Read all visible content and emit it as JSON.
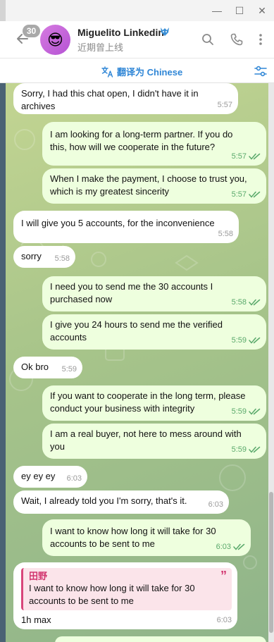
{
  "window": {
    "minimize_glyph": "—",
    "maximize_glyph": "☐",
    "close_glyph": "✕"
  },
  "header": {
    "unread_count": "30",
    "name": "Miguelito Linkedin",
    "status": "近期曾上线",
    "avatar_emoji": "😎",
    "icons": [
      "arrow-left-icon",
      "verified-wolf-icon",
      "search-icon",
      "phone-icon",
      "more-vertical-icon"
    ]
  },
  "translate_bar": {
    "label": "翻译为 Chinese",
    "icons": [
      "translate-icon",
      "settings-sliders-icon"
    ]
  },
  "messages": [
    {
      "dir": "in",
      "lines": [
        "Sorry, I had this chat open, I didn't have it in",
        "archives"
      ],
      "time": "5:57"
    },
    {
      "dir": "out",
      "lines": [
        "I am looking for a long-term partner. If you do",
        "this, how will we cooperate in the future?"
      ],
      "time": "5:57",
      "read": true
    },
    {
      "dir": "out",
      "lines": [
        "When I make the payment, I choose to trust you,",
        "which is my greatest sincerity"
      ],
      "time": "5:57",
      "read": true
    },
    {
      "dir": "in",
      "lines": [
        "I will give you 5 accounts, for the inconvenience"
      ],
      "time": "5:58"
    },
    {
      "dir": "in",
      "lines": [
        "sorry"
      ],
      "time": "5:58"
    },
    {
      "dir": "out",
      "lines": [
        "I need you to send me the 30 accounts I",
        "purchased now"
      ],
      "time": "5:58",
      "read": true
    },
    {
      "dir": "out",
      "lines": [
        "I give you 24 hours to send me the verified",
        "accounts"
      ],
      "time": "5:59",
      "read": true
    },
    {
      "dir": "in",
      "lines": [
        "Ok bro"
      ],
      "time": "5:59"
    },
    {
      "dir": "out",
      "lines": [
        "If you want to cooperate in the long term, please",
        "conduct your business with integrity"
      ],
      "time": "5:59",
      "read": true
    },
    {
      "dir": "out",
      "lines": [
        "I am a real buyer, not here to mess around with",
        "you"
      ],
      "time": "5:59",
      "read": true
    },
    {
      "dir": "in",
      "lines": [
        "ey ey ey"
      ],
      "time": "6:03"
    },
    {
      "dir": "in",
      "lines": [
        "Wait, I already told you I'm sorry, that's it."
      ],
      "time": "6:03"
    },
    {
      "dir": "out",
      "lines": [
        "I want to know how long it will take for 30",
        "accounts to be sent to me"
      ],
      "time": "6:03",
      "read": true
    },
    {
      "dir": "in",
      "reply": {
        "name": "田野",
        "lines": [
          "I want to know how long it will take for 30",
          "accounts to be sent to me"
        ]
      },
      "lines": [
        "1h max"
      ],
      "time": "6:03"
    }
  ],
  "colors": {
    "incoming_bubble": "#ffffff",
    "outgoing_bubble": "#eeffde",
    "read_ticks": "#5aa96b",
    "link_blue": "#2f86d6",
    "reply_accent": "#d2356f"
  }
}
